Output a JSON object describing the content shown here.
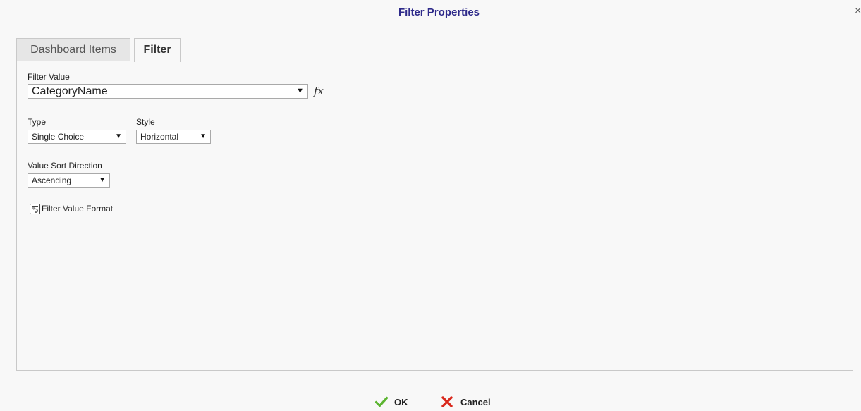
{
  "dialog": {
    "title": "Filter Properties",
    "close_glyph": "×"
  },
  "tabs": [
    {
      "label": "Dashboard Items",
      "active": false
    },
    {
      "label": "Filter",
      "active": true
    }
  ],
  "filter_value": {
    "label": "Filter Value",
    "value": "CategoryName",
    "dropdown_glyph": "▼",
    "fx_glyph": "fx"
  },
  "type": {
    "label": "Type",
    "value": "Single Choice",
    "dropdown_glyph": "▼"
  },
  "style": {
    "label": "Style",
    "value": "Horizontal",
    "dropdown_glyph": "▼"
  },
  "sort_direction": {
    "label": "Value Sort Direction",
    "value": "Ascending",
    "dropdown_glyph": "▼"
  },
  "format_link": {
    "label": "Filter Value Format",
    "icon": "format-icon"
  },
  "footer": {
    "ok_label": "OK",
    "cancel_label": "Cancel",
    "ok_icon": "checkmark-icon",
    "cancel_icon": "x-icon",
    "ok_color": "#5cb531",
    "cancel_color": "#d9281c"
  },
  "colors": {
    "title": "#2e2a8a",
    "background": "#f8f8f8",
    "border": "#c9c9c9"
  }
}
